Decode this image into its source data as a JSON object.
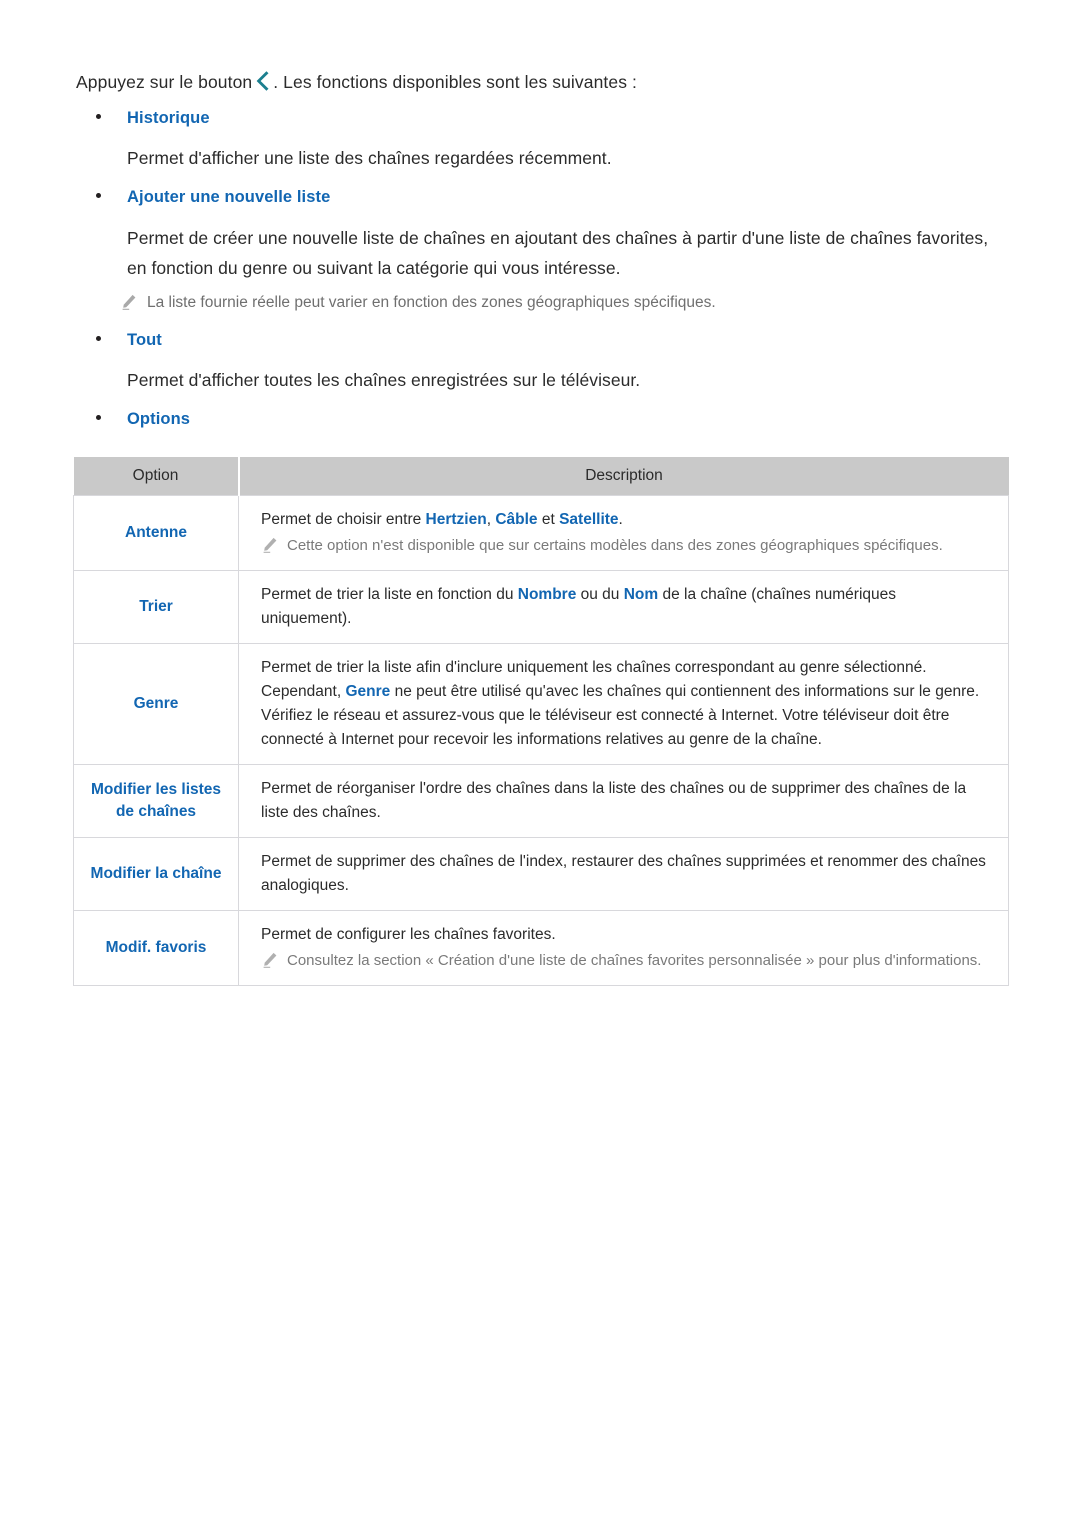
{
  "document": {
    "intro": {
      "before_icon": "Appuyez sur le bouton",
      "icon_name": "chevron-left-icon",
      "after_icon": ". Les fonctions disponibles sont les suivantes :"
    },
    "sections": [
      {
        "id": "historique",
        "heading": "Historique",
        "body": "Permet d'afficher une liste des chaînes regardées récemment."
      },
      {
        "id": "ajouter-une-nouvelle-liste",
        "heading": "Ajouter une nouvelle liste",
        "body_line1": "Permet de créer une nouvelle liste de chaînes en ajoutant des chaînes à partir d'une liste de chaînes favorites,",
        "body_line2": "en fonction du genre ou suivant la catégorie qui vous intéresse.",
        "note": "La liste fournie réelle peut varier en fonction des zones géographiques spécifiques."
      },
      {
        "id": "tout",
        "heading": "Tout",
        "body": "Permet d'afficher toutes les chaînes enregistrées sur le téléviseur."
      },
      {
        "id": "options",
        "heading": "Options"
      }
    ],
    "table": {
      "headers": [
        "Option",
        "Description"
      ],
      "rows": [
        {
          "option": "Antenne",
          "desc_parts": [
            "Permet de choisir entre ",
            "Hertzien",
            ", ",
            "Câble",
            " et ",
            "Satellite",
            "."
          ],
          "note": "Cette option n'est disponible que sur certains modèles dans des zones géographiques spécifiques."
        },
        {
          "option": "Trier",
          "desc_parts": [
            "Permet de trier la liste en fonction du ",
            "Nombre",
            " ou du ",
            "Nom",
            " de la chaîne (chaînes numériques uniquement)."
          ]
        },
        {
          "option": "Genre",
          "line1": "Permet de trier la liste afin d'inclure uniquement les chaînes correspondant au genre sélectionné.",
          "line2_a": "Cependant, ",
          "line2_kw": "Genre",
          "line2_b": " ne peut être utilisé qu'avec les chaînes qui contiennent des informations sur le genre.",
          "line3": "Vérifiez le réseau et assurez-vous que le téléviseur est connecté à Internet. Votre téléviseur doit être connecté à Internet pour recevoir les informations relatives au genre de la chaîne."
        },
        {
          "option_line1": "Modifier les listes",
          "option_line2": "de chaînes",
          "desc": "Permet de réorganiser l'ordre des chaînes dans la liste des chaînes ou de supprimer des chaînes de la liste des chaînes."
        },
        {
          "option": "Modifier la chaîne",
          "desc": "Permet de supprimer des chaînes de l'index, restaurer des chaînes supprimées et renommer des chaînes analogiques."
        },
        {
          "option": "Modif. favoris",
          "desc": "Permet de configurer les chaînes favorites.",
          "note": "Consultez la section « Création d'une liste de chaînes favorites personnalisée » pour plus d'informations."
        }
      ]
    },
    "colors": {
      "heading_blue": "#1266b2",
      "chevron_teal": "#1b7f8f",
      "table_header_gray": "#c9c9c9",
      "note_gray": "#6f6f6f",
      "body_text": "#2b2b2b",
      "table_border": "#d8d8dc"
    }
  }
}
